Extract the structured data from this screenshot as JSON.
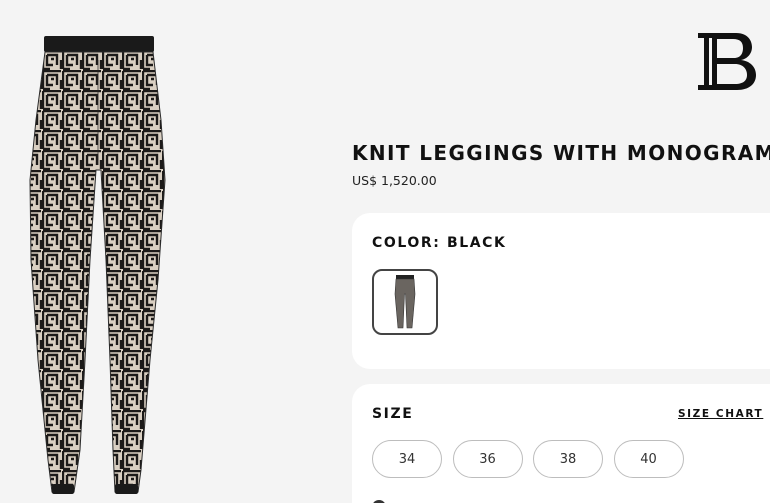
{
  "product": {
    "title": "KNIT LEGGINGS WITH MONOGRAM",
    "price": "US$ 1,520.00"
  },
  "color_section": {
    "heading": "COLOR: BLACK",
    "swatches": [
      "black"
    ]
  },
  "size_section": {
    "heading": "SIZE",
    "size_chart_label": "SIZE CHART",
    "sizes": [
      "34",
      "36",
      "38",
      "40"
    ]
  },
  "icons": {
    "logo": "balmain-b-monogram-logo",
    "swatch": "leggings-thumbnail"
  },
  "colors": {
    "background": "#f4f4f4",
    "card": "#ffffff",
    "text": "#111111",
    "pattern_dark": "#1c1a19",
    "pattern_light": "#d9cfc2"
  }
}
